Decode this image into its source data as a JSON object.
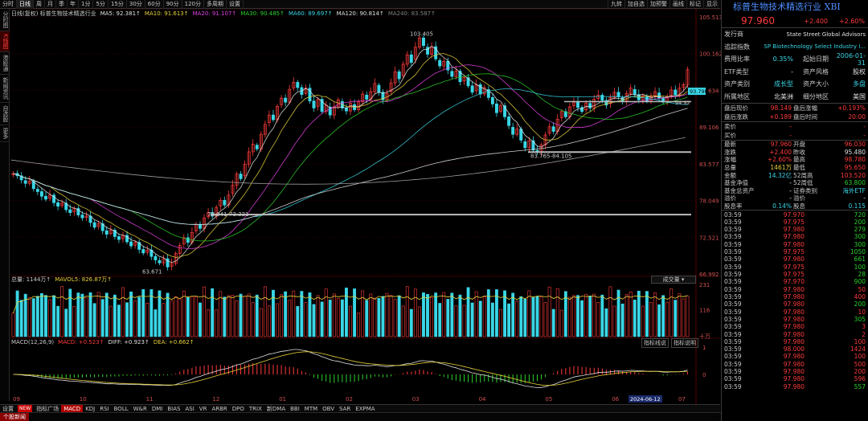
{
  "toolbar": {
    "items": [
      "分时",
      "日线",
      "周",
      "月",
      "季",
      "年",
      "1分",
      "5分",
      "15分",
      "30分",
      "60分",
      "90分",
      "120分",
      "多周期",
      "设置"
    ],
    "active_index": 1,
    "right_items": [
      "九转",
      "加自选",
      "加预警",
      "画线",
      "标记",
      "显示"
    ]
  },
  "sidebar": {
    "tabs": [
      "分时图",
      "K线图",
      "港股通",
      "新闻资讯",
      "自选股",
      "更多"
    ],
    "active_index": 1
  },
  "price_chart": {
    "legend": [
      {
        "text": "日线(复权) 标普生物技术精选行业",
        "color": "#c8c8c8"
      },
      {
        "text": "MA5: 92.381↑",
        "color": "#e0e0e0"
      },
      {
        "text": "MA10: 91.613↑",
        "color": "#e8d23a"
      },
      {
        "text": "MA20: 91.107↑",
        "color": "#e040e0"
      },
      {
        "text": "MA30: 90.485↑",
        "color": "#2dd22d"
      },
      {
        "text": "MA60: 89.697↑",
        "color": "#39d6e6"
      },
      {
        "text": "MA120: 90.814↑",
        "color": "#e0e0e0"
      },
      {
        "text": "MA240: 83.587↑",
        "color": "#808080"
      }
    ],
    "y_labels": [
      "105.513",
      "100.162",
      "94.634",
      "89.106",
      "83.577",
      "78.049",
      "72.521",
      "66.992"
    ],
    "annotations": {
      "high": "103.405",
      "low": "63.671",
      "gap1": "73.041-73.321",
      "gap2": "83.765-84.105",
      "right_tag": "93.798",
      "right_tag2": "94.92"
    }
  },
  "volume_chart": {
    "legend": [
      {
        "text": "总量: 1144万↑",
        "color": "#c8c8c8"
      },
      {
        "text": "MAVOL5: 826.87万↑",
        "color": "#e8d23a"
      }
    ],
    "y_labels": [
      "231",
      "116",
      "十万"
    ],
    "dropdown": "成交量"
  },
  "macd_chart": {
    "legend": [
      {
        "text": "MACD(12,26,9)",
        "color": "#c8c8c8"
      },
      {
        "text": "MACD: +0.523↑",
        "color": "#ff3b3b"
      },
      {
        "text": "DIFF: +0.923↑",
        "color": "#e0e0e0"
      },
      {
        "text": "DEA: +0.662↑",
        "color": "#e8d23a"
      }
    ],
    "buttons": [
      "指标线说",
      "指标说明"
    ],
    "y_labels": [
      "1",
      "0"
    ]
  },
  "x_axis": {
    "labels": [
      "09",
      "10",
      "11",
      "12",
      "01",
      "02",
      "03",
      "04",
      "05",
      "06",
      "07"
    ],
    "highlight": "2024-06-12"
  },
  "bottombar": {
    "items": [
      "设置",
      "NEW",
      "指标广场",
      "MACD",
      "KDJ",
      "RSI",
      "BOLL",
      "W&R",
      "DMI",
      "BIAS",
      "ASI",
      "VR",
      "ARBR",
      "DPO",
      "TRIX",
      "新DMA",
      "BBI",
      "MTM",
      "OBV",
      "SAR",
      "EXPMA"
    ],
    "active_index": 3
  },
  "footer": {
    "label": "个股新闻"
  },
  "panel": {
    "title": "标普生物技术精选行业 XBI",
    "price": "97.960",
    "change": "+2.400",
    "change_pct": "+2.60%",
    "info": [
      {
        "k": "发行商",
        "v": "State Street Global Advisors",
        "vc": "white"
      },
      {
        "k": "追踪指数",
        "v": "SP Biotechnology Select Industry I...",
        "vc": "cyan"
      },
      {
        "k": "费用比率",
        "v": "0.35%",
        "k2": "起始日期",
        "v2": "2006-01-31",
        "vc": "cyan"
      },
      {
        "k": "ETF类型",
        "v": "-",
        "k2": "资产风格",
        "v2": "股权",
        "vc": "white"
      },
      {
        "k": "资产类别",
        "v": "成长型",
        "k2": "资产大小",
        "v2": "多盘",
        "vc": "cyan"
      },
      {
        "k": "所属地区",
        "v": "北美洲",
        "k2": "细分地区",
        "v2": "美国",
        "vc": "white"
      }
    ],
    "after_hours": [
      {
        "k": "盘后现价",
        "v": "98.149",
        "k2": "盘后涨幅",
        "v2": "+0.193%"
      },
      {
        "k": "盘后涨跌",
        "v": "+0.189",
        "k2": "盘后时间",
        "v2": "20:00"
      }
    ],
    "buy_sell": [
      {
        "k": "卖价",
        "v": "-",
        "v2": "-"
      },
      {
        "k": "买价",
        "v": "-",
        "v2": "-"
      }
    ],
    "stats": [
      {
        "k": "最新",
        "v": "97.960",
        "vc": "red",
        "k2": "开盘",
        "v2": "96.030",
        "v2c": "red"
      },
      {
        "k": "涨跌",
        "v": "+2.400",
        "vc": "red",
        "k2": "昨收",
        "v2": "95.480",
        "v2c": "white"
      },
      {
        "k": "涨幅",
        "v": "+2.60%",
        "vc": "red",
        "k2": "最高",
        "v2": "98.780",
        "v2c": "red"
      },
      {
        "k": "总量",
        "v": "1461万",
        "vc": "yellow",
        "k2": "最低",
        "v2": "95.650",
        "v2c": "red"
      },
      {
        "k": "金额",
        "v": "14.32亿",
        "vc": "cyan",
        "k2": "52周高",
        "v2": "103.520",
        "v2c": "red"
      },
      {
        "k": "基金净值",
        "v": "-",
        "vc": "white",
        "k2": "52周低",
        "v2": "63.800",
        "v2c": "green"
      },
      {
        "k": "基金总资产",
        "v": "-",
        "vc": "white",
        "k2": "证券类别",
        "v2": "海外ETF",
        "v2c": "cyan"
      },
      {
        "k": "溢价",
        "v": "-",
        "vc": "white",
        "k2": "溢价",
        "v2": "-",
        "v2c": "white"
      },
      {
        "k": "股息率",
        "v": "0.14%",
        "vc": "cyan",
        "k2": "股息",
        "v2": "0.115",
        "v2c": "cyan"
      }
    ],
    "ticks": [
      {
        "t": "03:59",
        "p": "97.970",
        "v": "720",
        "c": "green"
      },
      {
        "t": "03:59",
        "p": "97.975",
        "v": "200",
        "c": "green"
      },
      {
        "t": "03:59",
        "p": "97.980",
        "v": "279",
        "c": "green"
      },
      {
        "t": "03:59",
        "p": "97.980",
        "v": "300",
        "c": "green"
      },
      {
        "t": "03:59",
        "p": "97.980",
        "v": "300",
        "c": "green"
      },
      {
        "t": "03:59",
        "p": "97.975",
        "v": "1050",
        "c": "green"
      },
      {
        "t": "03:59",
        "p": "97.980",
        "v": "661",
        "c": "green"
      },
      {
        "t": "03:59",
        "p": "97.975",
        "v": "100",
        "c": "green"
      },
      {
        "t": "03:59",
        "p": "97.975",
        "v": "28",
        "c": "green"
      },
      {
        "t": "03:59",
        "p": "97.970",
        "v": "900",
        "c": "green"
      },
      {
        "t": "03:59",
        "p": "97.980",
        "v": "50",
        "c": "red"
      },
      {
        "t": "03:59",
        "p": "97.980",
        "v": "400",
        "c": "red"
      },
      {
        "t": "03:59",
        "p": "97.980",
        "v": "200",
        "c": "green"
      },
      {
        "t": "03:59",
        "p": "97.980",
        "v": "10",
        "c": "red"
      },
      {
        "t": "03:59",
        "p": "97.980",
        "v": "305",
        "c": "green"
      },
      {
        "t": "03:59",
        "p": "97.980",
        "v": "3",
        "c": "red"
      },
      {
        "t": "03:59",
        "p": "97.980",
        "v": "2",
        "c": "red"
      },
      {
        "t": "03:59",
        "p": "97.980",
        "v": "100",
        "c": "red"
      },
      {
        "t": "03:59",
        "p": "98.000",
        "v": "1424",
        "c": "red"
      },
      {
        "t": "03:59",
        "p": "97.980",
        "v": "100",
        "c": "red"
      },
      {
        "t": "03:59",
        "p": "97.980",
        "v": "500",
        "c": "red"
      },
      {
        "t": "03:59",
        "p": "97.980",
        "v": "200",
        "c": "red"
      },
      {
        "t": "03:59",
        "p": "97.980",
        "v": "596",
        "c": "red"
      },
      {
        "t": "03:59",
        "p": "97.980",
        "v": "557",
        "c": "green"
      }
    ]
  },
  "chart_data": {
    "type": "candlestick",
    "note_series": "approximate daily closes, Sep 2023 - Jul 2024",
    "y_range": [
      63,
      107
    ],
    "closes": [
      80.2,
      79.8,
      79.1,
      78.5,
      78.9,
      77.6,
      77.1,
      76.3,
      75.8,
      76.5,
      75.2,
      74.6,
      75.1,
      74.0,
      73.5,
      74.2,
      73.1,
      72.6,
      72.9,
      71.8,
      71.0,
      71.6,
      70.4,
      69.8,
      70.5,
      69.4,
      68.9,
      69.6,
      68.5,
      67.8,
      68.4,
      67.2,
      66.6,
      67.1,
      66.0,
      65.4,
      64.9,
      65.6,
      64.2,
      64.8,
      66.5,
      67.9,
      69.2,
      68.4,
      70.1,
      71.5,
      70.8,
      72.6,
      73.5,
      72.9,
      74.4,
      75.6,
      74.8,
      76.5,
      78.2,
      80.1,
      79.3,
      81.8,
      83.9,
      85.2,
      84.4,
      86.9,
      88.6,
      90.2,
      89.4,
      91.7,
      93.1,
      92.4,
      94.6,
      95.8,
      94.9,
      93.7,
      94.8,
      92.6,
      91.4,
      92.9,
      90.8,
      91.9,
      90.2,
      91.6,
      92.8,
      91.4,
      90.9,
      92.2,
      91.1,
      92.5,
      93.8,
      92.9,
      94.2,
      95.6,
      94.1,
      92.8,
      93.9,
      95.7,
      97.6,
      96.4,
      98.9,
      100.5,
      99.2,
      101.8,
      103.4,
      102.1,
      100.6,
      101.9,
      99.8,
      98.6,
      99.4,
      97.9,
      96.8,
      97.7,
      95.9,
      96.6,
      95.2,
      94.1,
      95.4,
      93.8,
      94.9,
      93.2,
      92.1,
      90.6,
      91.8,
      89.9,
      88.4,
      86.9,
      87.8,
      85.9,
      84.6,
      85.8,
      84.2,
      83.9,
      85.1,
      86.8,
      88.2,
      87.4,
      89.5,
      90.8,
      89.9,
      91.6,
      92.4,
      91.5,
      90.8,
      92.2,
      91.4,
      92.9,
      93.6,
      92.7,
      91.9,
      93.2,
      94.1,
      93.3,
      92.6,
      93.9,
      94.8,
      93.7,
      92.8,
      93.5,
      92.6,
      93.4,
      94.2,
      93.1,
      92.4,
      93.3,
      94.5,
      93.6,
      94.8,
      95.4,
      97.96
    ]
  }
}
